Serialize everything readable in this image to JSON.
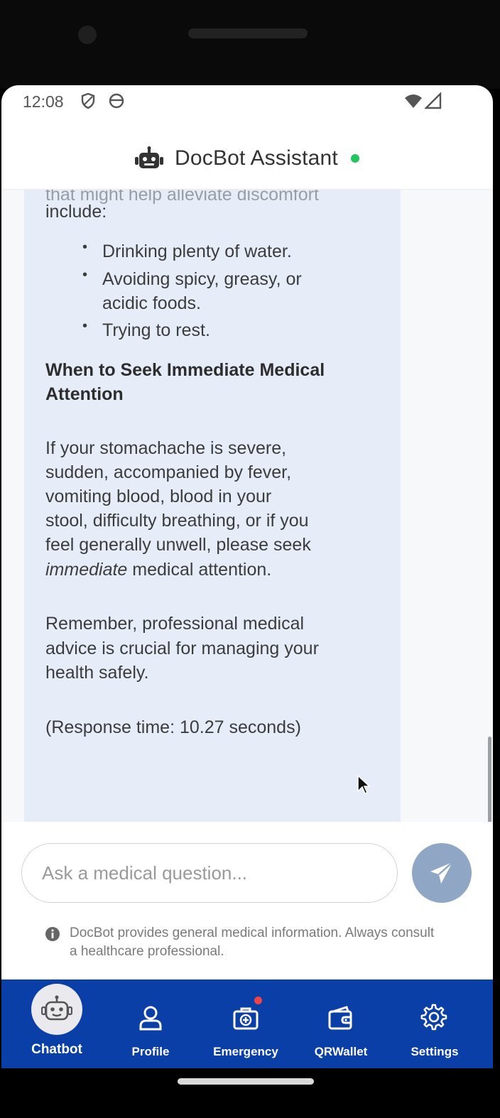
{
  "status_bar": {
    "time": "12:08"
  },
  "app_bar": {
    "title": "DocBot Assistant"
  },
  "message": {
    "cut_line": "that might help alleviate discomfort",
    "intro_tail": "include:",
    "bullets": [
      "Drinking plenty of water.",
      "Avoiding spicy, greasy, or",
      "acidic foods.",
      "Trying to rest."
    ],
    "heading_line1": "When to Seek Immediate Medical",
    "heading_line2": "Attention",
    "p1_lines": [
      "If your stomachache is severe,",
      "sudden, accompanied by fever,",
      "vomiting blood, blood in your",
      "stool, difficulty breathing, or if you",
      "feel generally unwell, please seek"
    ],
    "p1_emph": "immediate",
    "p1_end": " medical attention.",
    "p2_lines": [
      "Remember, professional medical",
      "advice is crucial for managing your",
      "health safely."
    ],
    "response_time": "(Response time: 10.27 seconds)"
  },
  "composer": {
    "placeholder": "Ask a medical question...",
    "disclaimer": "DocBot provides general medical information. Always consult a healthcare professional."
  },
  "nav": {
    "chatbot": "Chatbot",
    "profile": "Profile",
    "emergency": "Emergency",
    "qrwallet": "QRWallet",
    "settings": "Settings"
  },
  "colors": {
    "nav_bg": "#0b3fa8",
    "bubble_bg": "#e6edf9",
    "online": "#22c55e",
    "send_btn": "#8fa6c4",
    "badge": "#ef4444"
  }
}
